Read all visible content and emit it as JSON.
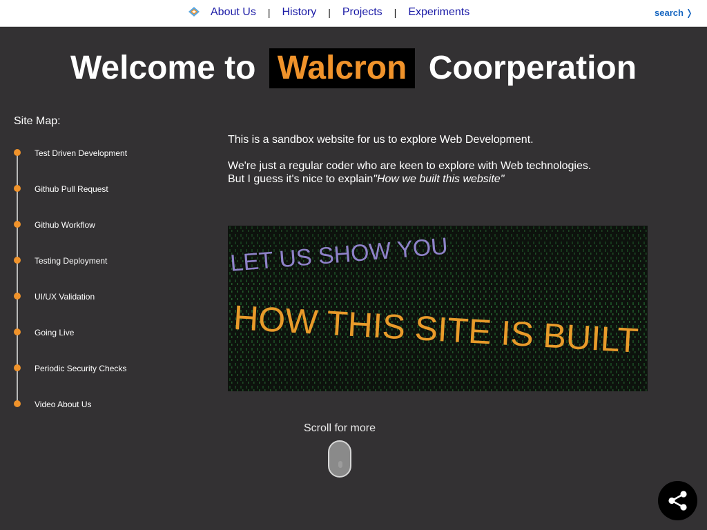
{
  "nav": {
    "logo_icon": "logo-icon",
    "links": [
      "About Us",
      "History",
      "Projects",
      "Experiments"
    ],
    "separator": "|",
    "search_label": "search",
    "search_chevron": "❭"
  },
  "title": {
    "before": "Welcome to",
    "brand": "Walcron",
    "after": "Coorperation"
  },
  "sitemap": {
    "heading": "Site Map:",
    "items": [
      "Test Driven Development",
      "Github Pull Request",
      "Github Workflow",
      "Testing Deployment",
      "UI/UX Validation",
      "Going Live",
      "Periodic Security Checks",
      "Video About Us"
    ]
  },
  "intro": {
    "line1": "This is a sandbox website for us to explore Web Development.",
    "line2": "We're just a regular coder who are keen to explore with Web technologies.",
    "line3_prefix": "But I guess it's nice to explain",
    "line3_emphasis": "\"How we built this website\""
  },
  "banner": {
    "line1": "LET US SHOW YOU",
    "line2": "HOW THIS SITE IS BUILT"
  },
  "scroll": {
    "label": "Scroll for more"
  },
  "colors": {
    "background": "#333133",
    "accent": "#f0932b",
    "nav_link": "#1a1aa6",
    "search": "#1565c0"
  },
  "share": {
    "icon": "share-icon"
  }
}
